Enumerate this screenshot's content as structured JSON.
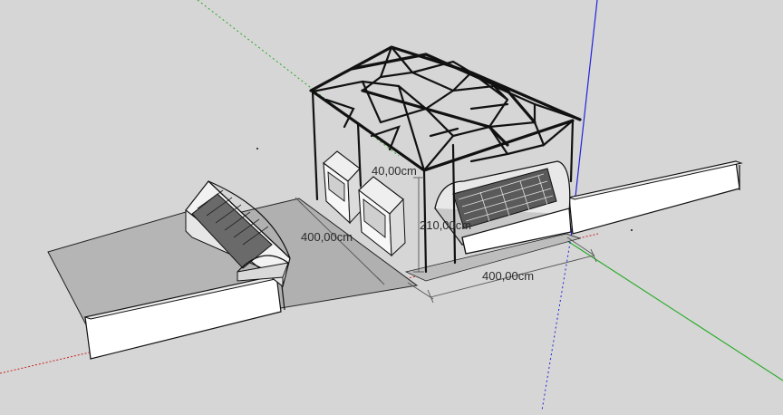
{
  "app": {
    "name": "",
    "view": "3d-model-viewport"
  },
  "colors": {
    "background": "#d6d6d6",
    "ground": "#b3b3b3",
    "wall": "#ffffff",
    "axis_red": "#cc2222",
    "axis_green": "#22aa22",
    "axis_blue": "#2222dd",
    "edge": "#111111"
  },
  "dimensions": {
    "depth_label": "400,00cm",
    "width_label": "400,00cm",
    "height_label": "210,00cm",
    "post_label": "40,00cm"
  },
  "objects": {
    "left_display_case": "refrigerated-display-case",
    "right_display_case": "curved-glass-display-counter",
    "upright_freezers": "upright-display-freezer",
    "roof_truss": "steel-roof-truss-frame",
    "low_walls": "perimeter-wall"
  }
}
